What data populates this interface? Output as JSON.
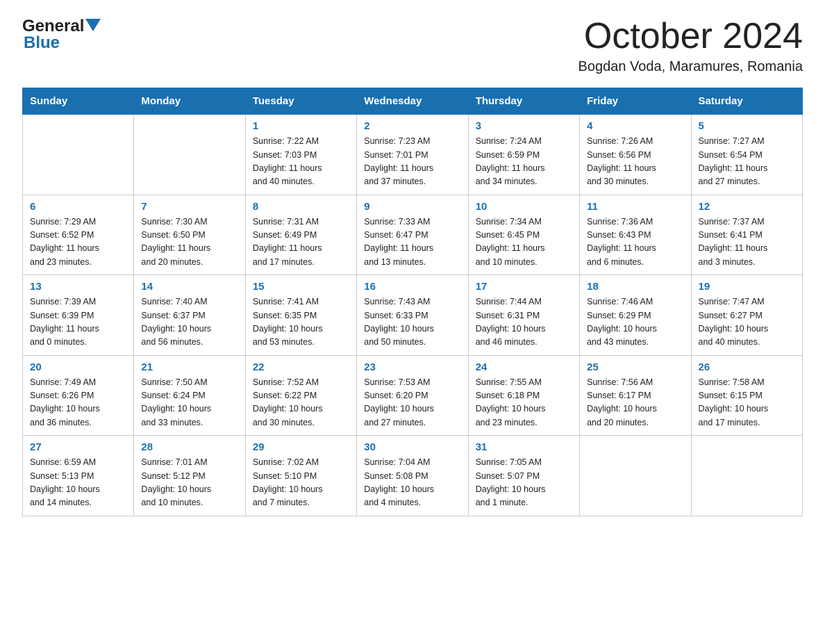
{
  "header": {
    "logo_general": "General",
    "logo_blue": "Blue",
    "month_title": "October 2024",
    "location": "Bogdan Voda, Maramures, Romania"
  },
  "days_of_week": [
    "Sunday",
    "Monday",
    "Tuesday",
    "Wednesday",
    "Thursday",
    "Friday",
    "Saturday"
  ],
  "weeks": [
    [
      {
        "day": "",
        "info": ""
      },
      {
        "day": "",
        "info": ""
      },
      {
        "day": "1",
        "info": "Sunrise: 7:22 AM\nSunset: 7:03 PM\nDaylight: 11 hours\nand 40 minutes."
      },
      {
        "day": "2",
        "info": "Sunrise: 7:23 AM\nSunset: 7:01 PM\nDaylight: 11 hours\nand 37 minutes."
      },
      {
        "day": "3",
        "info": "Sunrise: 7:24 AM\nSunset: 6:59 PM\nDaylight: 11 hours\nand 34 minutes."
      },
      {
        "day": "4",
        "info": "Sunrise: 7:26 AM\nSunset: 6:56 PM\nDaylight: 11 hours\nand 30 minutes."
      },
      {
        "day": "5",
        "info": "Sunrise: 7:27 AM\nSunset: 6:54 PM\nDaylight: 11 hours\nand 27 minutes."
      }
    ],
    [
      {
        "day": "6",
        "info": "Sunrise: 7:29 AM\nSunset: 6:52 PM\nDaylight: 11 hours\nand 23 minutes."
      },
      {
        "day": "7",
        "info": "Sunrise: 7:30 AM\nSunset: 6:50 PM\nDaylight: 11 hours\nand 20 minutes."
      },
      {
        "day": "8",
        "info": "Sunrise: 7:31 AM\nSunset: 6:49 PM\nDaylight: 11 hours\nand 17 minutes."
      },
      {
        "day": "9",
        "info": "Sunrise: 7:33 AM\nSunset: 6:47 PM\nDaylight: 11 hours\nand 13 minutes."
      },
      {
        "day": "10",
        "info": "Sunrise: 7:34 AM\nSunset: 6:45 PM\nDaylight: 11 hours\nand 10 minutes."
      },
      {
        "day": "11",
        "info": "Sunrise: 7:36 AM\nSunset: 6:43 PM\nDaylight: 11 hours\nand 6 minutes."
      },
      {
        "day": "12",
        "info": "Sunrise: 7:37 AM\nSunset: 6:41 PM\nDaylight: 11 hours\nand 3 minutes."
      }
    ],
    [
      {
        "day": "13",
        "info": "Sunrise: 7:39 AM\nSunset: 6:39 PM\nDaylight: 11 hours\nand 0 minutes."
      },
      {
        "day": "14",
        "info": "Sunrise: 7:40 AM\nSunset: 6:37 PM\nDaylight: 10 hours\nand 56 minutes."
      },
      {
        "day": "15",
        "info": "Sunrise: 7:41 AM\nSunset: 6:35 PM\nDaylight: 10 hours\nand 53 minutes."
      },
      {
        "day": "16",
        "info": "Sunrise: 7:43 AM\nSunset: 6:33 PM\nDaylight: 10 hours\nand 50 minutes."
      },
      {
        "day": "17",
        "info": "Sunrise: 7:44 AM\nSunset: 6:31 PM\nDaylight: 10 hours\nand 46 minutes."
      },
      {
        "day": "18",
        "info": "Sunrise: 7:46 AM\nSunset: 6:29 PM\nDaylight: 10 hours\nand 43 minutes."
      },
      {
        "day": "19",
        "info": "Sunrise: 7:47 AM\nSunset: 6:27 PM\nDaylight: 10 hours\nand 40 minutes."
      }
    ],
    [
      {
        "day": "20",
        "info": "Sunrise: 7:49 AM\nSunset: 6:26 PM\nDaylight: 10 hours\nand 36 minutes."
      },
      {
        "day": "21",
        "info": "Sunrise: 7:50 AM\nSunset: 6:24 PM\nDaylight: 10 hours\nand 33 minutes."
      },
      {
        "day": "22",
        "info": "Sunrise: 7:52 AM\nSunset: 6:22 PM\nDaylight: 10 hours\nand 30 minutes."
      },
      {
        "day": "23",
        "info": "Sunrise: 7:53 AM\nSunset: 6:20 PM\nDaylight: 10 hours\nand 27 minutes."
      },
      {
        "day": "24",
        "info": "Sunrise: 7:55 AM\nSunset: 6:18 PM\nDaylight: 10 hours\nand 23 minutes."
      },
      {
        "day": "25",
        "info": "Sunrise: 7:56 AM\nSunset: 6:17 PM\nDaylight: 10 hours\nand 20 minutes."
      },
      {
        "day": "26",
        "info": "Sunrise: 7:58 AM\nSunset: 6:15 PM\nDaylight: 10 hours\nand 17 minutes."
      }
    ],
    [
      {
        "day": "27",
        "info": "Sunrise: 6:59 AM\nSunset: 5:13 PM\nDaylight: 10 hours\nand 14 minutes."
      },
      {
        "day": "28",
        "info": "Sunrise: 7:01 AM\nSunset: 5:12 PM\nDaylight: 10 hours\nand 10 minutes."
      },
      {
        "day": "29",
        "info": "Sunrise: 7:02 AM\nSunset: 5:10 PM\nDaylight: 10 hours\nand 7 minutes."
      },
      {
        "day": "30",
        "info": "Sunrise: 7:04 AM\nSunset: 5:08 PM\nDaylight: 10 hours\nand 4 minutes."
      },
      {
        "day": "31",
        "info": "Sunrise: 7:05 AM\nSunset: 5:07 PM\nDaylight: 10 hours\nand 1 minute."
      },
      {
        "day": "",
        "info": ""
      },
      {
        "day": "",
        "info": ""
      }
    ]
  ]
}
